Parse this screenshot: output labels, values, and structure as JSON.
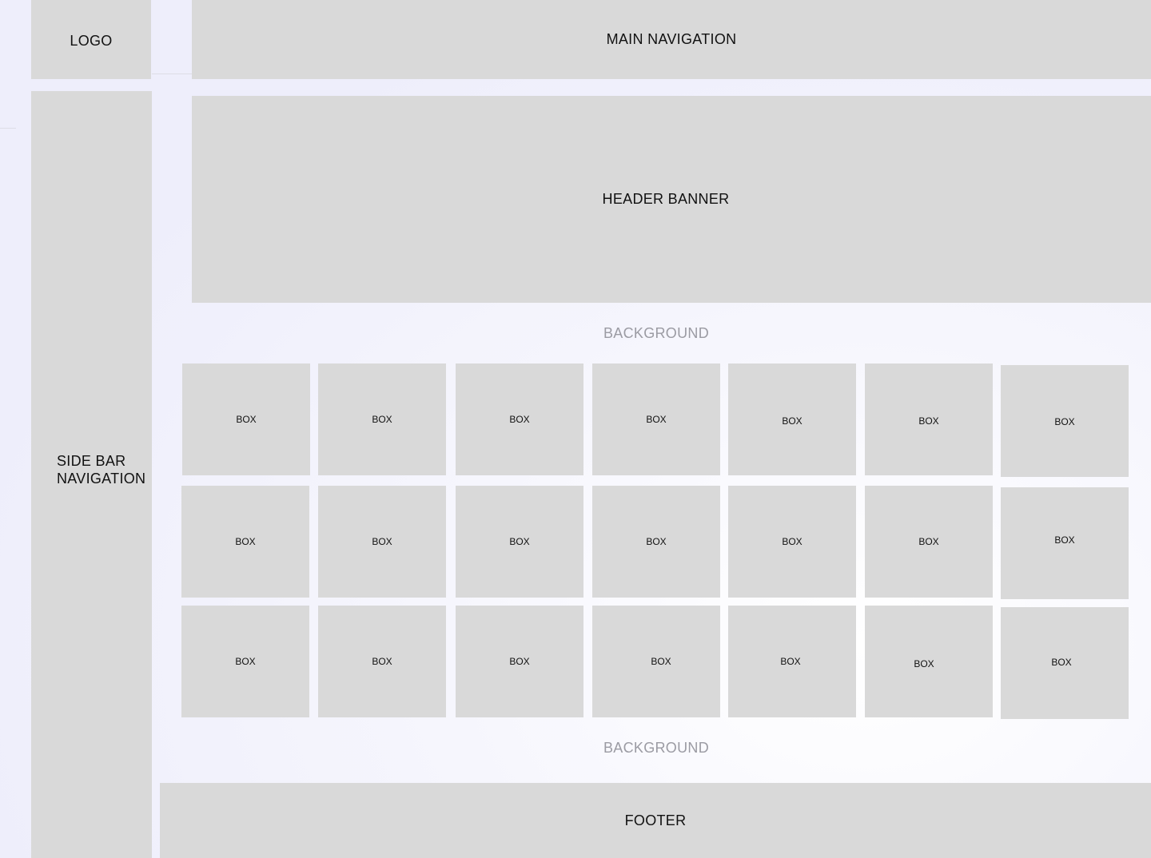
{
  "logo": {
    "label": "LOGO"
  },
  "main_nav": {
    "label": "MAIN NAVIGATION"
  },
  "sidebar": {
    "label_line1": "SIDE BAR",
    "label_line2": "NAVIGATION"
  },
  "header": {
    "label": "HEADER BANNER"
  },
  "background": {
    "top_label": "BACKGROUND",
    "bottom_label": "BACKGROUND"
  },
  "footer": {
    "label": "FOOTER"
  },
  "grid": {
    "boxes": [
      "BOX",
      "BOX",
      "BOX",
      "BOX",
      "BOX",
      "BOX",
      "BOX",
      "BOX",
      "BOX",
      "BOX",
      "BOX",
      "BOX",
      "BOX",
      "BOX",
      "BOX",
      "BOX",
      "BOX",
      "BOX",
      "BOX",
      "BOX",
      "BOX"
    ]
  },
  "colors": {
    "block_fill": "#d9d9d9",
    "page_background": "#eeeefb",
    "muted_text": "#9b9ba3"
  }
}
